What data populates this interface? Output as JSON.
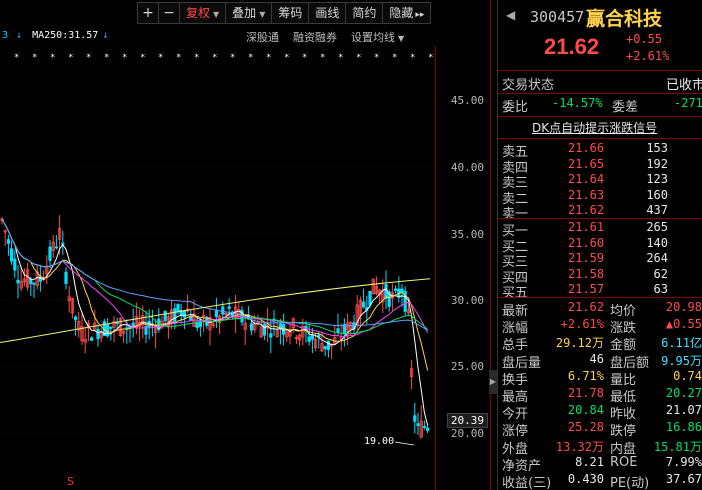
{
  "toolbar": {
    "plus": "+",
    "minus": "−",
    "adjust_label": "复权",
    "overlay_label": "叠加",
    "chips_label": "筹码",
    "draw_label": "画线",
    "simple_label": "简约",
    "hide_label": "隐藏",
    "more": "▸▸"
  },
  "ma_legend": {
    "lead": "3",
    "text": "MA250:31.57"
  },
  "sub_tools": [
    "深股通",
    "融资融券",
    "设置均线"
  ],
  "price_axis": [
    "45.00",
    "40.00",
    "35.00",
    "30.00",
    "25.00",
    "20.00"
  ],
  "current_price_tag": "20.39",
  "low_label": "19.00",
  "signal_mark": "S",
  "stock": {
    "code": "300457",
    "name": "赢合科技",
    "price": "21.62",
    "change": "+0.55",
    "change_pct": "+2.61%"
  },
  "trade_state": {
    "label": "交易状态",
    "value": "已收市"
  },
  "commission": {
    "ratio_label": "委比",
    "ratio": "-14.57%",
    "diff_label": "委差",
    "diff": "-271"
  },
  "dk_link": "DK点自动提示涨跌信号",
  "sell_orders": [
    {
      "label": "卖五",
      "price": "21.66",
      "vol": "153"
    },
    {
      "label": "卖四",
      "price": "21.65",
      "vol": "192"
    },
    {
      "label": "卖三",
      "price": "21.64",
      "vol": "123"
    },
    {
      "label": "卖二",
      "price": "21.63",
      "vol": "160"
    },
    {
      "label": "卖一",
      "price": "21.62",
      "vol": "437"
    }
  ],
  "buy_orders": [
    {
      "label": "买一",
      "price": "21.61",
      "vol": "265"
    },
    {
      "label": "买二",
      "price": "21.60",
      "vol": "140"
    },
    {
      "label": "买三",
      "price": "21.59",
      "vol": "264"
    },
    {
      "label": "买四",
      "price": "21.58",
      "vol": "62"
    },
    {
      "label": "买五",
      "price": "21.57",
      "vol": "63"
    }
  ],
  "stats": [
    {
      "l1": "最新",
      "v1": "21.62",
      "c1": "red",
      "l2": "均价",
      "v2": "20.98",
      "c2": "red"
    },
    {
      "l1": "涨幅",
      "v1": "+2.61%",
      "c1": "red",
      "l2": "涨跌",
      "v2": "▲0.55",
      "c2": "red"
    },
    {
      "l1": "总手",
      "v1": "29.12万",
      "c1": "yellow",
      "l2": "金额",
      "v2": "6.11亿",
      "c2": "cyan"
    },
    {
      "l1": "盘后量",
      "v1": "46",
      "c1": "white",
      "l2": "盘后额",
      "v2": "9.95万",
      "c2": "cyan"
    },
    {
      "l1": "换手",
      "v1": "6.71%",
      "c1": "yellow",
      "l2": "量比",
      "v2": "0.74",
      "c2": "yellow"
    },
    {
      "l1": "最高",
      "v1": "21.78",
      "c1": "red",
      "l2": "最低",
      "v2": "20.27",
      "c2": "green"
    },
    {
      "l1": "今开",
      "v1": "20.84",
      "c1": "green",
      "l2": "昨收",
      "v2": "21.07",
      "c2": "white"
    },
    {
      "l1": "涨停",
      "v1": "25.28",
      "c1": "red",
      "l2": "跌停",
      "v2": "16.86",
      "c2": "green"
    },
    {
      "l1": "外盘",
      "v1": "13.32万",
      "c1": "red",
      "l2": "内盘",
      "v2": "15.81万",
      "c2": "green"
    },
    {
      "l1": "净资产",
      "v1": "8.21",
      "c1": "white",
      "l2": "ROE",
      "v2": "7.99%",
      "c2": "white"
    },
    {
      "l1": "收益(三)",
      "v1": "0.430",
      "c1": "white",
      "l2": "PE(动)",
      "v2": "37.67",
      "c2": "white"
    }
  ],
  "colors": {
    "up": "#ff4a4a",
    "down": "#00e060",
    "name": "#ffd24a",
    "frame": "#7a0000",
    "candle_up": "#ff4a4a",
    "candle_down": "#00dfff",
    "ma5": "#ffffff",
    "ma10": "#ffd24a",
    "ma20": "#ff40ff",
    "ma30": "#00e060",
    "ma60": "#5fa0ff",
    "ma250": "#f0f070"
  }
}
